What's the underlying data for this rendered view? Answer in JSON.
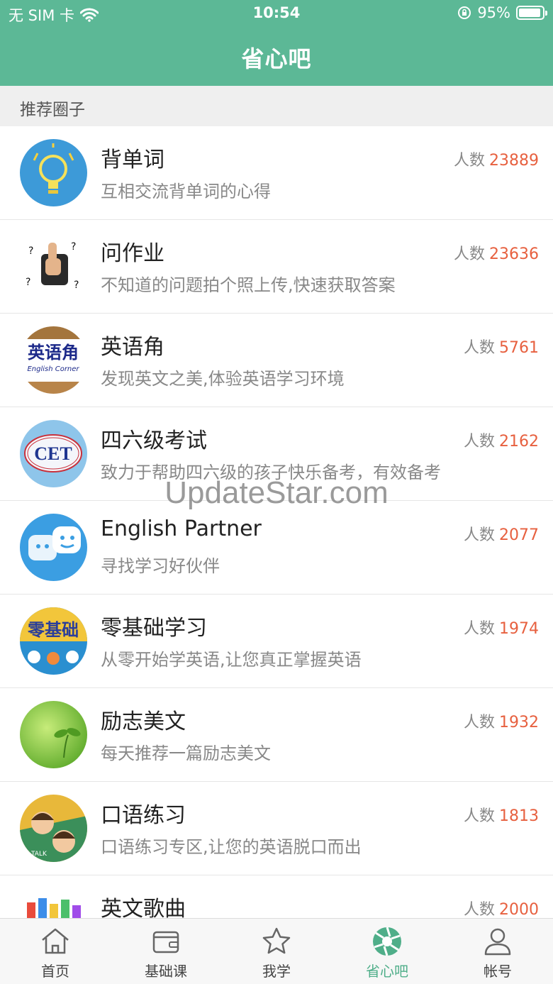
{
  "status": {
    "carrier": "无 SIM 卡",
    "time": "10:54",
    "battery": "95%",
    "battery_level": 0.95
  },
  "header": {
    "title": "省心吧"
  },
  "section": {
    "title": "推荐圈子"
  },
  "count_label": "人数",
  "groups": [
    {
      "name": "背单词",
      "desc": "互相交流背单词的心得",
      "count": "23889",
      "icon": "lightbulb-avatar"
    },
    {
      "name": "问作业",
      "desc": "不知道的问题拍个照上传,快速获取答案",
      "count": "23636",
      "icon": "thumbs-up-avatar"
    },
    {
      "name": "英语角",
      "desc": "发现英文之美,体验英语学习环境",
      "count": "5761",
      "icon": "english-corner-avatar",
      "avatar_text": "英语角",
      "avatar_sub": "English Corner"
    },
    {
      "name": "四六级考试",
      "desc": "致力于帮助四六级的孩子快乐备考，有效备考",
      "count": "2162",
      "icon": "cet-avatar",
      "avatar_text": "CET"
    },
    {
      "name": "English Partner",
      "desc": "寻找学习好伙伴",
      "count": "2077",
      "icon": "chat-bubbles-avatar"
    },
    {
      "name": "零基础学习",
      "desc": "从零开始学英语,让您真正掌握英语",
      "count": "1974",
      "icon": "zero-basics-avatar",
      "avatar_text": "零基础"
    },
    {
      "name": "励志美文",
      "desc": "每天推荐一篇励志美文",
      "count": "1932",
      "icon": "sprout-avatar"
    },
    {
      "name": "口语练习",
      "desc": "口语练习专区,让您的英语脱口而出",
      "count": "1813",
      "icon": "speaking-avatar",
      "avatar_text": "TALK"
    },
    {
      "name": "英文歌曲",
      "desc": "",
      "count": "2000",
      "icon": "music-avatar"
    }
  ],
  "watermark": "UpdateStar.com",
  "tabs": [
    {
      "label": "首页",
      "icon": "home-icon"
    },
    {
      "label": "基础课",
      "icon": "wallet-icon"
    },
    {
      "label": "我学",
      "icon": "star-icon"
    },
    {
      "label": "省心吧",
      "icon": "aperture-icon",
      "active": true
    },
    {
      "label": "帐号",
      "icon": "person-icon"
    }
  ],
  "colors": {
    "primary": "#5cb896",
    "count_number": "#e7603f",
    "active_tab": "#4fae89"
  }
}
